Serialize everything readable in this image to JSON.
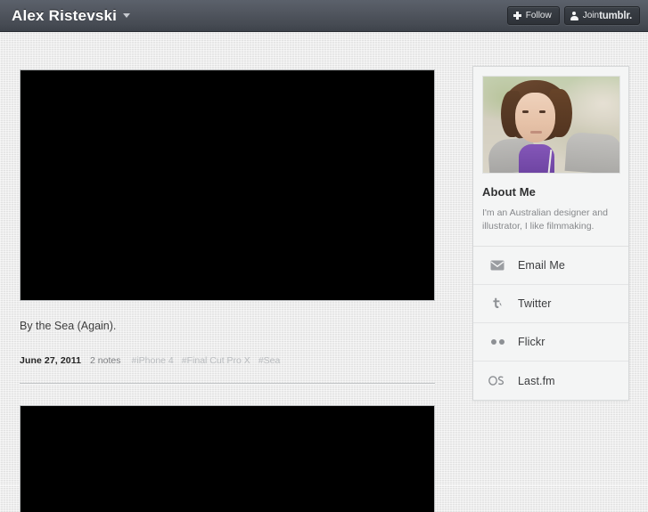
{
  "topbar": {
    "blog_title": "Alex Ristevski",
    "caret_icon": "chevron-down-icon",
    "follow_button": {
      "icon": "plus-icon",
      "label": "Follow"
    },
    "join_button": {
      "icon": "person-icon",
      "label": "Join ",
      "brand": "tumblr."
    }
  },
  "posts": [
    {
      "media_type": "video",
      "caption": "By the Sea (Again).",
      "date": "June 27, 2011",
      "notes": "2 notes",
      "tags": [
        "#iPhone 4",
        "#Final Cut Pro X",
        "#Sea"
      ]
    },
    {
      "media_type": "video"
    }
  ],
  "sidebar": {
    "avatar_alt": "portrait-photo",
    "about_title": "About Me",
    "about_text": "I'm an Australian designer and illustrator, I like filmmaking.",
    "links": [
      {
        "label": "Email Me",
        "icon": "envelope-icon"
      },
      {
        "label": "Twitter",
        "icon": "twitter-bird-icon"
      },
      {
        "label": "Flickr",
        "icon": "flickr-dots-icon"
      },
      {
        "label": "Last.fm",
        "icon": "lastfm-icon"
      }
    ]
  },
  "colors": {
    "topbar": "#4a4f57",
    "page_bg": "#e8e8e8",
    "card_bg": "#f4f5f5",
    "media_bg": "#000000",
    "text_dark": "#3d3d3d",
    "text_muted": "#7d7f82",
    "tag": "#b9bcbf"
  }
}
